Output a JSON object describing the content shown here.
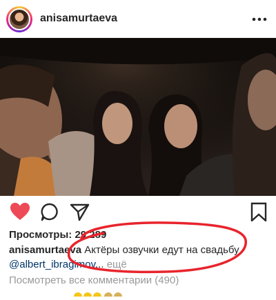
{
  "header": {
    "username": "anisamurtaeva",
    "avatar_icon": "avatar",
    "more_icon": "more-options-icon"
  },
  "media": {
    "tag_icon": "person-tag-icon",
    "sound_icon": "speaker-icon"
  },
  "actions": {
    "like_icon": "heart-icon",
    "like_color": "#ed4956",
    "comment_icon": "comment-icon",
    "share_icon": "paper-plane-icon",
    "save_icon": "bookmark-icon"
  },
  "post": {
    "views_label": "Просмотры:",
    "views_count": "29 289",
    "caption_user": "anisamurtaeva",
    "caption_text": "Актёры озвучки едут на свадьбу ·",
    "mention": "@albert_ibragimov",
    "mention_ellipsis": "...",
    "more_label": "ещё",
    "all_comments": "Посмотреть все комментарии (490)"
  },
  "annotation": {
    "highlight_color": "#e8242c"
  }
}
